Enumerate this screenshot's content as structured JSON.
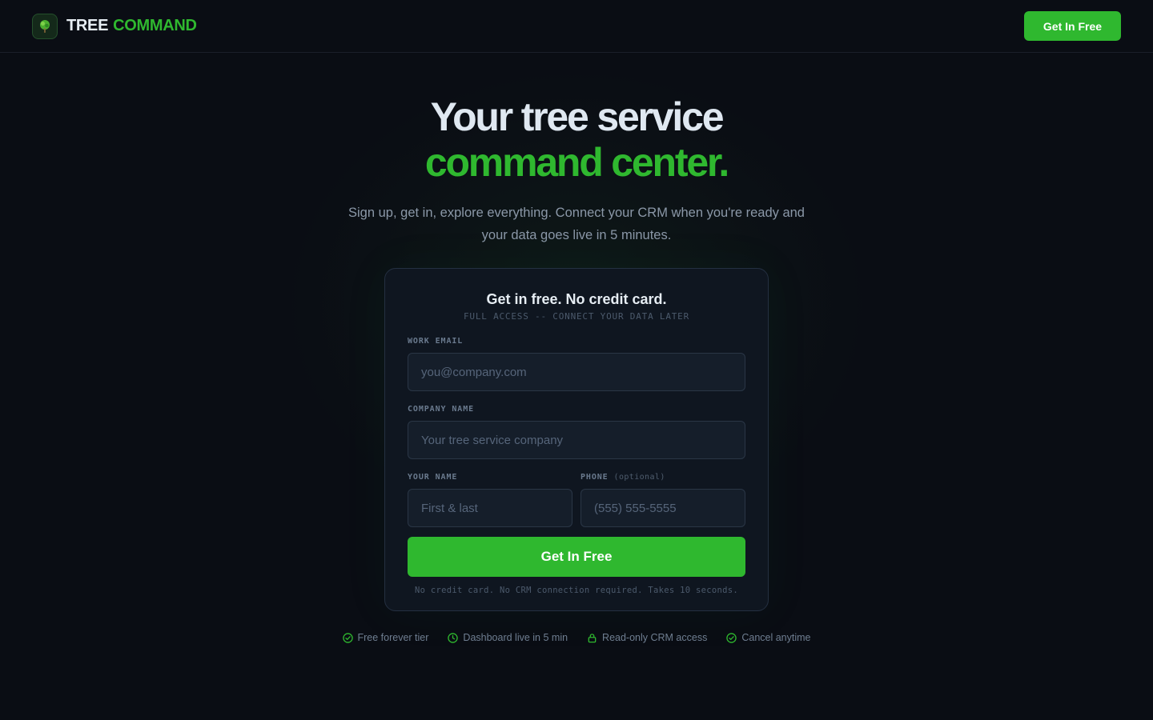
{
  "nav": {
    "brand_word1": "TREE",
    "brand_word2": "COMMAND",
    "logo_icon": "tree-icon",
    "cta_label": "Get In Free"
  },
  "hero": {
    "headline_line1": "Your tree service",
    "headline_line2": "command center.",
    "subtext": "Sign up, get in, explore everything. Connect your CRM when you're ready and your data goes live in 5 minutes."
  },
  "form": {
    "title": "Get in free. No credit card.",
    "subtitle": "FULL ACCESS -- CONNECT YOUR DATA LATER",
    "email_label": "WORK EMAIL",
    "email_placeholder": "you@company.com",
    "email_value": "",
    "company_label": "COMPANY NAME",
    "company_placeholder": "Your tree service company",
    "company_value": "",
    "name_label": "YOUR NAME",
    "name_placeholder": "First & last",
    "name_value": "",
    "phone_label": "PHONE",
    "phone_optional": "(optional)",
    "phone_placeholder": "(555) 555-5555",
    "phone_value": "",
    "submit_label": "Get In Free",
    "note": "No credit card. No CRM connection required. Takes 10 seconds."
  },
  "perks": [
    {
      "icon": "check-circle-icon",
      "label": "Free forever tier"
    },
    {
      "icon": "clock-icon",
      "label": "Dashboard live in 5 min"
    },
    {
      "icon": "lock-icon",
      "label": "Read-only CRM access"
    },
    {
      "icon": "check-circle-icon",
      "label": "Cancel anytime"
    }
  ],
  "colors": {
    "background": "#0a0d14",
    "accent": "#2fb82f",
    "card": "#0f1620",
    "muted_text": "#8b98a8"
  }
}
